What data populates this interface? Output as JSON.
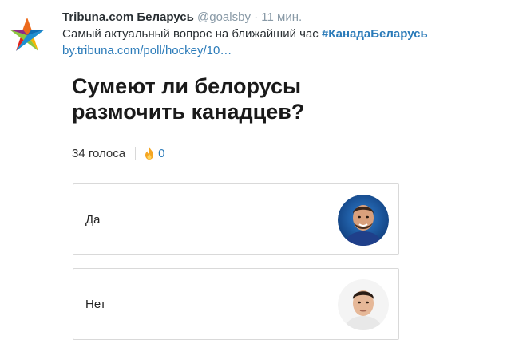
{
  "tweet": {
    "author_name": "Tribuna.com Беларусь",
    "handle": "@goalsby",
    "separator": "·",
    "time": "11 мин.",
    "text": "Самый актуальный вопрос на ближайший час ",
    "hashtag": "#КанадаБеларусь",
    "link": "by.tribuna.com/poll/hockey/10…"
  },
  "poll": {
    "title": "Сумеют ли белорусы\nразмочить канадцев?",
    "votes": "34 голоса",
    "fire_count": "0",
    "options": [
      {
        "label": "Да",
        "photo": "player-photo-blue-background"
      },
      {
        "label": "Нет",
        "photo": "player-photo-white-background"
      }
    ]
  },
  "colors": {
    "link": "#2b7bb9",
    "muted": "#8899a6",
    "fire": "#f5a623",
    "border": "#d9d9d9"
  }
}
